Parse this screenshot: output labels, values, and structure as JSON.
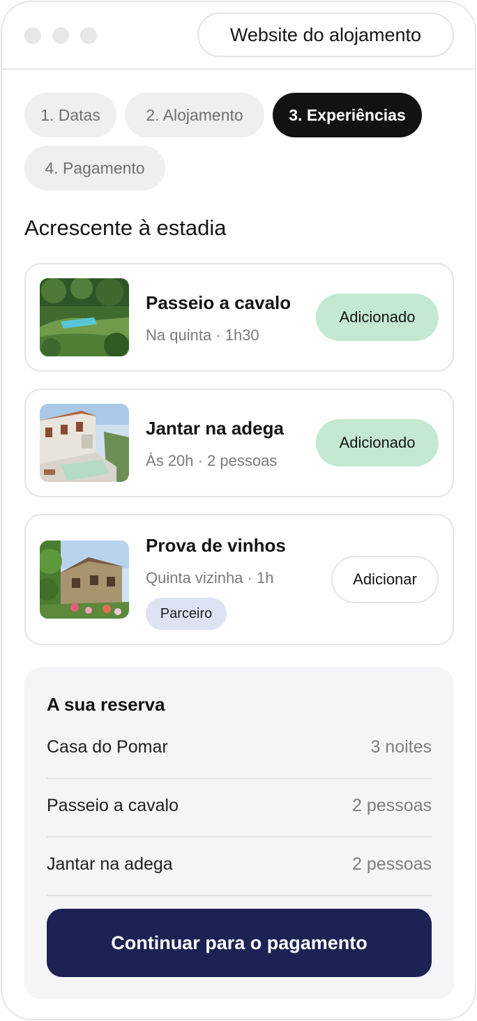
{
  "header": {
    "site_button": "Website do alojamento"
  },
  "steps": [
    {
      "label": "1. Datas",
      "active": false
    },
    {
      "label": "2. Alojamento",
      "active": false
    },
    {
      "label": "3. Experiências",
      "active": true
    },
    {
      "label": "4. Pagamento",
      "active": false
    }
  ],
  "section_title": "Acrescente à estadia",
  "experiences": [
    {
      "title": "Passeio a cavalo",
      "subtitle": "Na quinta · 1h30",
      "action": "Adicionado",
      "added": true
    },
    {
      "title": "Jantar na adega",
      "subtitle": "Às 20h · 2 pessoas",
      "action": "Adicionado",
      "added": true
    },
    {
      "title": "Prova de vinhos",
      "subtitle": "Quinta vizinha · 1h",
      "badge": "Parceiro",
      "action": "Adicionar",
      "added": false
    }
  ],
  "summary": {
    "title": "A sua reserva",
    "rows": [
      {
        "label": "Casa do Pomar",
        "value": "3 noites"
      },
      {
        "label": "Passeio a cavalo",
        "value": "2 pessoas"
      },
      {
        "label": "Jantar na adega",
        "value": "2 pessoas"
      }
    ],
    "cta": "Continuar para o pagamento"
  },
  "colors": {
    "added_button": "#c4e8d1",
    "active_step": "#121212",
    "cta": "#1c2253",
    "badge": "#dde3f3"
  }
}
